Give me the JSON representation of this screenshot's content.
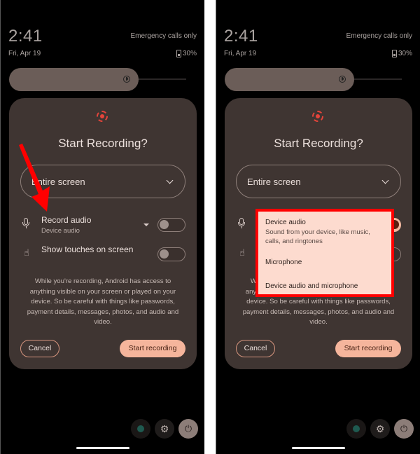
{
  "status": {
    "time": "2:41",
    "date": "Fri, Apr 19",
    "carrier": "Emergency calls only",
    "battery": "30%"
  },
  "brightness": {
    "level_fraction": 0.72
  },
  "dialog": {
    "title": "Start Recording?",
    "target_select": {
      "value": "Entire screen"
    },
    "record_audio": {
      "label": "Record audio",
      "source": "Device audio"
    },
    "show_touches": {
      "label": "Show touches on screen"
    },
    "notice": "While you're recording, Android has access to anything visible on your screen or played on your device. So be careful with things like passwords, payment details, messages, photos, and audio and video.",
    "cancel_label": "Cancel",
    "start_label": "Start recording"
  },
  "panels": [
    {
      "record_audio_on": false,
      "show_touches_on": false,
      "annotation": "red-arrow"
    },
    {
      "record_audio_on": true,
      "show_touches_on": false,
      "annotation": "red-box"
    }
  ],
  "audio_menu": {
    "items": [
      {
        "title": "Device audio",
        "subtitle": "Sound from your device, like music, calls, and ringtones"
      },
      {
        "title": "Microphone"
      },
      {
        "title": "Device audio and microphone"
      }
    ]
  },
  "quick_actions": {
    "user_icon": "user-icon",
    "settings_icon": "gear-icon",
    "power_icon": "power-icon"
  },
  "colors": {
    "accent": "#f5b59c",
    "record_red": "#e5443b",
    "dialog_bg": "#3f3532",
    "annotation": "#ff0000"
  }
}
